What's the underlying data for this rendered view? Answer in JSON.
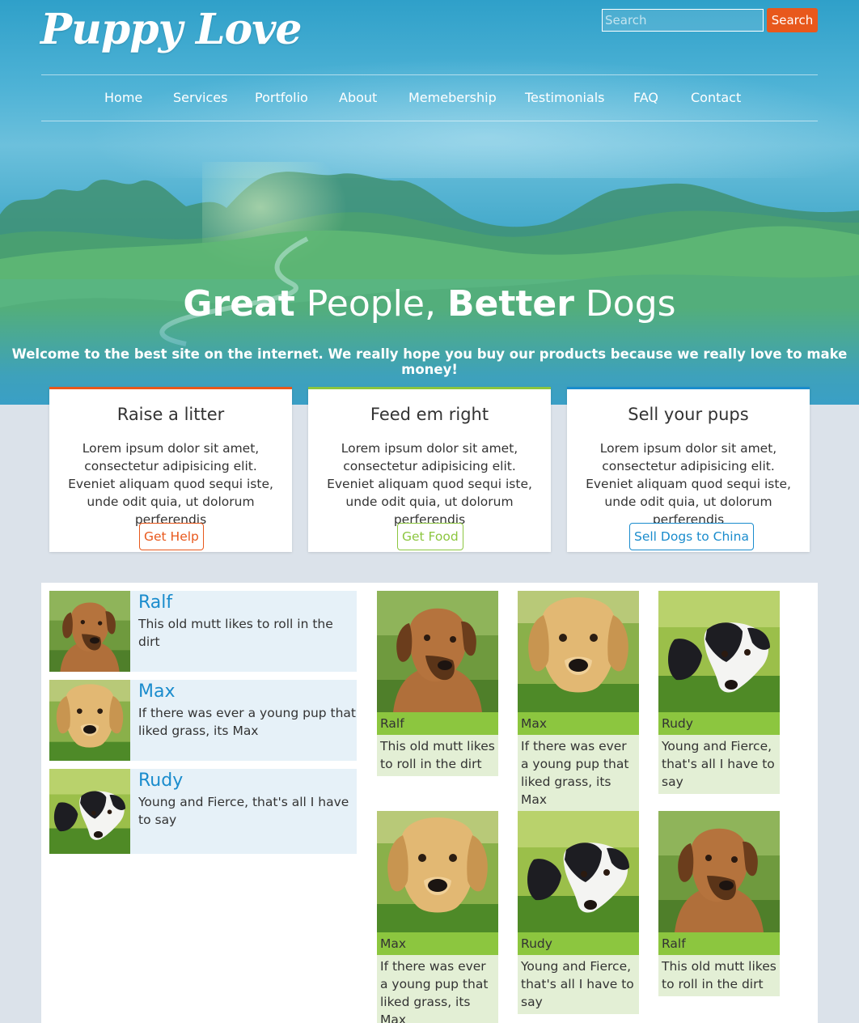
{
  "brand": {
    "logo": "Puppy Love"
  },
  "search": {
    "placeholder": "Search",
    "button_label": "Search"
  },
  "nav": {
    "items": [
      "Home",
      "Services",
      "Portfolio",
      "About",
      "Memebership",
      "Testimonials",
      "FAQ",
      "Contact"
    ]
  },
  "hero": {
    "title_parts": [
      "Great",
      " People, ",
      "Better",
      " Dogs"
    ],
    "subtitle": "Welcome to the best site on the internet. We really hope you buy our products because we really love to make money!"
  },
  "cards": [
    {
      "title": "Raise a litter",
      "text": "Lorem ipsum dolor sit amet, consectetur adipisicing elit. Eveniet aliquam quod sequi iste, unde odit quia, ut dolorum perferendis",
      "button": "Get Help",
      "accent": "#e8581c"
    },
    {
      "title": "Feed em right",
      "text": "Lorem ipsum dolor sit amet, consectetur adipisicing elit. Eveniet aliquam quod sequi iste, unde odit quia, ut dolorum perferendis",
      "button": "Get Food",
      "accent": "#8cc63f"
    },
    {
      "title": "Sell your pups",
      "text": "Lorem ipsum dolor sit amet, consectetur adipisicing elit. Eveniet aliquam quod sequi iste, unde odit quia, ut dolorum perferendis",
      "button": "Sell Dogs to China",
      "accent": "#1a8ccd"
    }
  ],
  "media_list": [
    {
      "name": "Ralf",
      "desc": "This old mutt likes to roll in the dirt",
      "dog": "ralf"
    },
    {
      "name": "Max",
      "desc": "If there was ever a young pup that liked grass, its Max",
      "dog": "max"
    },
    {
      "name": "Rudy",
      "desc": "Young and Fierce, that's all I have to say",
      "dog": "rudy"
    }
  ],
  "gallery": [
    {
      "name": "Ralf",
      "desc": "This old mutt likes to roll in the dirt",
      "dog": "ralf"
    },
    {
      "name": "Max",
      "desc": "If there was ever a young pup that liked grass, its Max",
      "dog": "max"
    },
    {
      "name": "Rudy",
      "desc": "Young and Fierce, that's all I have to say",
      "dog": "rudy"
    },
    {
      "name": "Max",
      "desc": "If there was ever a young pup that liked grass, its Max",
      "dog": "max"
    },
    {
      "name": "Rudy",
      "desc": "Young and Fierce, that's all I have to say",
      "dog": "rudy"
    },
    {
      "name": "Ralf",
      "desc": "This old mutt likes to roll in the dirt",
      "dog": "ralf"
    }
  ],
  "colors": {
    "orange": "#e8581c",
    "green": "#8cc63f",
    "blue": "#1a8ccd",
    "page_bg": "#dbe2ea"
  }
}
